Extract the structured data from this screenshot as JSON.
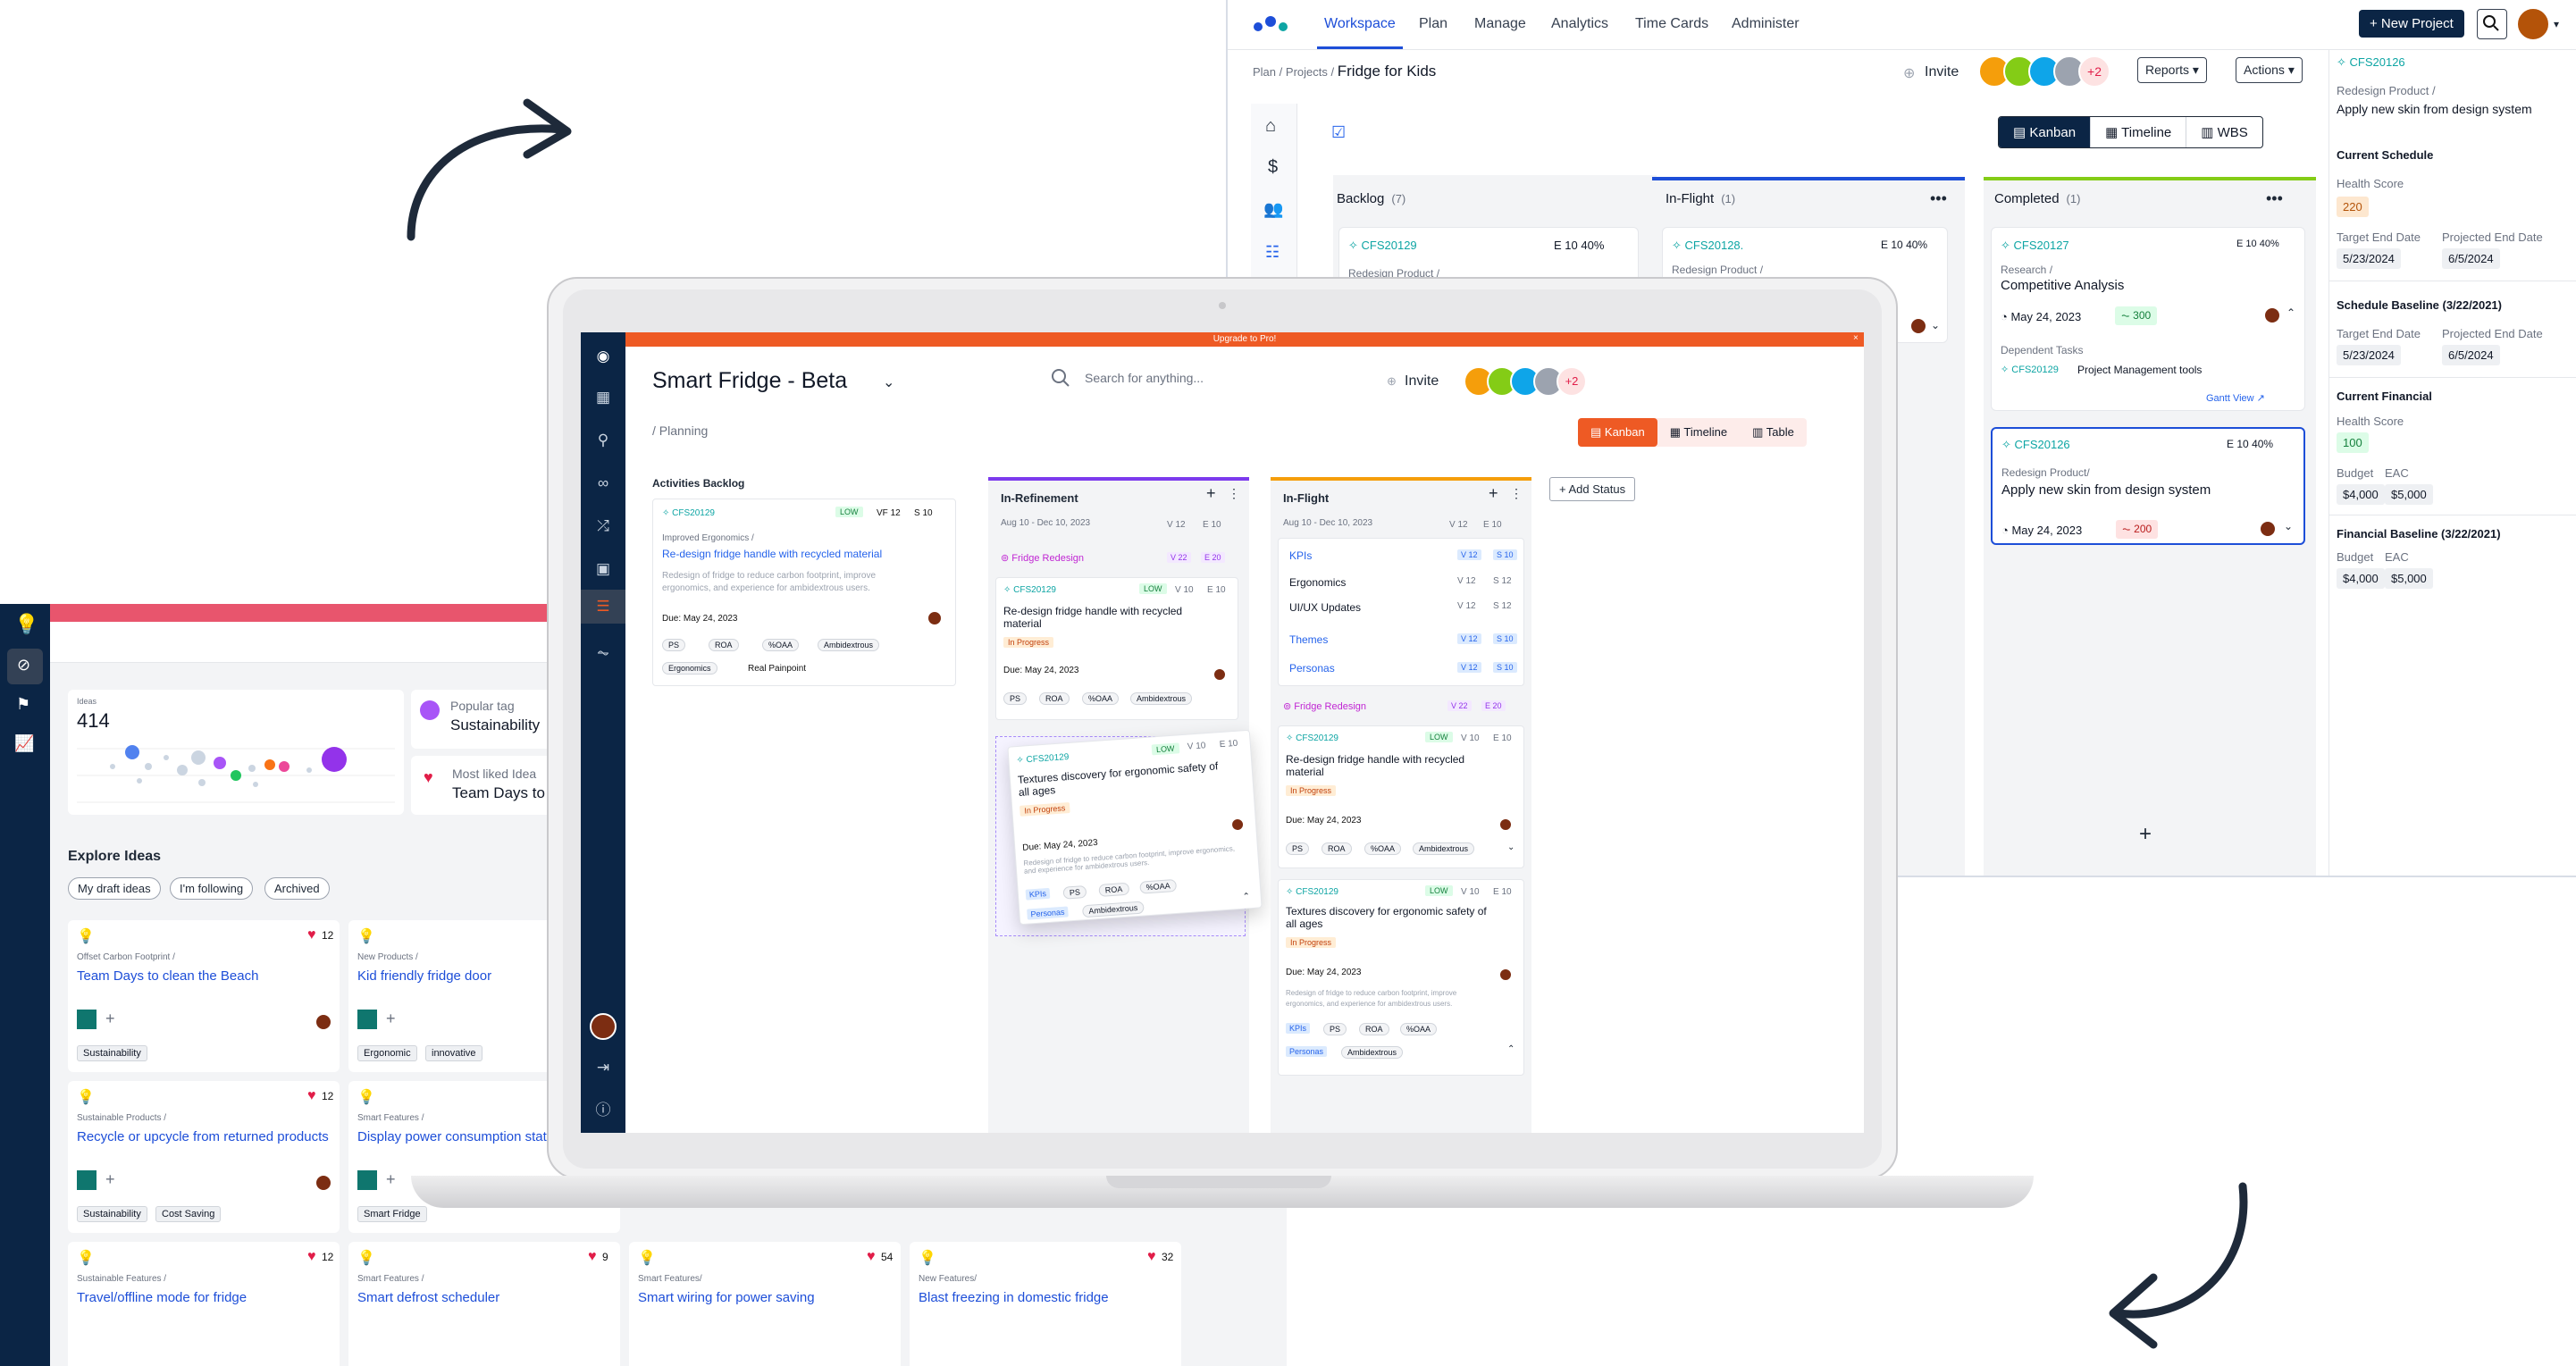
{
  "workspace": {
    "nav": [
      "Workspace",
      "Plan",
      "Manage",
      "Analytics",
      "Time Cards",
      "Administer"
    ],
    "new_project": "+ New Project",
    "breadcrumb": [
      "Plan",
      "/",
      "Projects",
      "/"
    ],
    "project_title": "Fridge for Kids",
    "invite": "Invite",
    "more_avatars": "+2",
    "reports": "Reports",
    "actions": "Actions",
    "views": [
      "Kanban",
      "Timeline",
      "WBS"
    ],
    "columns": [
      {
        "name": "Backlog",
        "count": "(7)"
      },
      {
        "name": "In-Flight",
        "count": "(1)"
      },
      {
        "name": "Completed",
        "count": "(1)"
      }
    ],
    "backlog_card": {
      "id": "CFS20129",
      "estimate": "E",
      "e_value": "10",
      "percent": "40%",
      "parent": "Redesign Product /"
    },
    "inflight_card": {
      "id": "CFS20128.",
      "estimate": "E",
      "e_value": "10",
      "percent": "40%",
      "parent": "Redesign Product /"
    },
    "completed_card1": {
      "id": "CFS20127",
      "estimate": "E",
      "e_value": "10",
      "percent": "40%",
      "parent": "Research /",
      "title": "Competitive Analysis",
      "date": "May 24, 2023",
      "score": "300",
      "dep_label": "Dependent Tasks",
      "dep_id": "CFS20129",
      "dep_title": "Project Management tools",
      "gantt": "Gantt View"
    },
    "completed_card2": {
      "id": "CFS20126",
      "estimate": "E",
      "e_value": "10",
      "percent": "40%",
      "parent": "Redesign Product/",
      "title": "Apply new skin from design system",
      "date": "May 24, 2023",
      "score": "200"
    },
    "add": "+",
    "side": {
      "id": "CFS20126",
      "parent": "Redesign Product /",
      "title": "Apply new skin from design system",
      "current_schedule": "Current Schedule",
      "health_label": "Health Score",
      "health_value": "220",
      "target_end": "Target End Date",
      "projected_end": "Projected End Date",
      "target_value": "5/23/2024",
      "projected_value": "6/5/2024",
      "schedule_baseline": "Schedule Baseline (3/22/2021)",
      "sb_target_value": "5/23/2024",
      "sb_projected_value": "6/5/2024",
      "current_financial": "Current Financial",
      "fin_health_value": "100",
      "budget": "Budget",
      "eac": "EAC",
      "budget_value": "$4,000",
      "eac_value": "$5,000",
      "financial_baseline": "Financial Baseline (3/22/2021)",
      "fb_budget_value": "$4,000",
      "fb_eac_value": "$5,000"
    }
  },
  "ideas": {
    "ideas_label": "Ideas",
    "ideas_count": "414",
    "popular_tag_label": "Popular tag",
    "popular_tag": "Sustainability",
    "most_liked_label": "Most liked Idea",
    "most_liked": "Team Days to",
    "explore": "Explore Ideas",
    "filters": [
      "My draft ideas",
      "I'm following",
      "Archived"
    ],
    "cards": [
      {
        "parent": "Offset Carbon Footprint /",
        "title": "Team Days to clean the Beach",
        "likes": "12",
        "tags": [
          "Sustainability"
        ]
      },
      {
        "parent": "New Products /",
        "title": "Kid friendly fridge door",
        "likes": "",
        "tags": [
          "Ergonomic",
          "innovative"
        ]
      },
      {
        "parent": "Sustainable Products /",
        "title": "Recycle or upcycle from returned products",
        "likes": "12",
        "tags": [
          "Sustainability",
          "Cost Saving"
        ]
      },
      {
        "parent": "Smart Features /",
        "title": "Display power consumption stats",
        "likes": "",
        "tags": [
          "Smart Fridge"
        ]
      },
      {
        "parent": "Sustainable Features /",
        "title": "Travel/offline mode for fridge",
        "likes": "12",
        "tags": []
      },
      {
        "parent": "Smart Features /",
        "title": "Smart defrost scheduler",
        "likes": "9",
        "tags": []
      },
      {
        "parent": "Smart Features/",
        "title": "Smart wiring for power saving",
        "likes": "54",
        "tags": []
      },
      {
        "parent": "New Features/",
        "title": "Blast freezing in domestic fridge",
        "likes": "32",
        "tags": []
      }
    ]
  },
  "app": {
    "upgrade": "Upgrade to Pro!",
    "title": "Smart Fridge - Beta",
    "search_placeholder": "Search for anything...",
    "invite": "Invite",
    "more_avatars": "+2",
    "crumb": "/ Planning",
    "views": [
      "Kanban",
      "Timeline",
      "Table"
    ],
    "backlog": {
      "heading": "Activities Backlog",
      "id": "CFS20129",
      "low": "LOW",
      "vf": "VF",
      "vf_value": "12",
      "s": "S",
      "s_value": "10",
      "parent": "Improved Ergonomics /",
      "title": "Re-design fridge handle with recycled material",
      "desc1": "Redesign of fridge to reduce carbon footprint, improve",
      "desc2": "ergonomics, and experience for ambidextrous users.",
      "due": "Due: May 24, 2023",
      "tags": [
        "PS",
        "ROA",
        "%OAA",
        "Ambidextrous",
        "Ergonomics"
      ],
      "pain": "Real Painpoint"
    },
    "refinement": {
      "name": "In-Refinement",
      "dates": "Aug 10 - Dec 10, 2023",
      "v": "V 12",
      "e": "E 10",
      "group": "Fridge Redesign",
      "gv": "V 22",
      "ge": "E 20",
      "card1": {
        "id": "CFS20129",
        "low": "LOW",
        "v": "V 10",
        "e": "E 10",
        "title1": "Re-design fridge handle with recycled",
        "title2": "material",
        "status": "In Progress",
        "due": "Due: May 24, 2023",
        "tags": [
          "PS",
          "ROA",
          "%OAA",
          "Ambidextrous"
        ]
      },
      "drag": {
        "id": "CFS20129",
        "low": "LOW",
        "v": "V 10",
        "e": "E 10",
        "title1": "Textures discovery for ergonomic safety of",
        "title2": "all ages",
        "status": "In Progress",
        "due": "Due: May 24, 2023",
        "desc": "Redesign of fridge to reduce carbon footprint, improve ergonomics, and experience for ambidextrous users.",
        "kpi": "KPIs",
        "pers": "Personas",
        "tags": [
          "PS",
          "ROA",
          "%OAA",
          "Ambidextrous"
        ]
      }
    },
    "inflight": {
      "name": "In-Flight",
      "dates": "Aug 10 - Dec 10, 2023",
      "v": "V 12",
      "e": "E 10",
      "rows": [
        {
          "name": "KPIs",
          "v": "V 12",
          "e": "S 10"
        },
        {
          "name": "Ergonomics",
          "v": "V 12",
          "e": "S 12"
        },
        {
          "name": "UI/UX Updates",
          "v": "V 12",
          "e": "S 12"
        },
        {
          "name": "Themes",
          "v": "V 12",
          "e": "S 10"
        },
        {
          "name": "Personas",
          "v": "V 12",
          "e": "S 10"
        }
      ],
      "group": "Fridge Redesign",
      "gv": "V 22",
      "ge": "E 20",
      "card1": {
        "id": "CFS20129",
        "low": "LOW",
        "v": "V 10",
        "e": "E 10",
        "title1": "Re-design fridge handle with recycled",
        "title2": "material",
        "status": "In Progress",
        "due": "Due: May 24, 2023",
        "tags": [
          "PS",
          "ROA",
          "%OAA",
          "Ambidextrous"
        ]
      },
      "card2": {
        "id": "CFS20129",
        "low": "LOW",
        "v": "V 10",
        "e": "E 10",
        "title1": "Textures discovery for ergonomic safety of",
        "title2": "all ages",
        "status": "In Progress",
        "due": "Due: May 24, 2023",
        "desc1": "Redesign of fridge to reduce carbon footprint, improve",
        "desc2": "ergonomics, and experience for ambidextrous users.",
        "kpi": "KPIs",
        "pers": "Personas",
        "tags": [
          "PS",
          "ROA",
          "%OAA",
          "Ambidextrous"
        ]
      }
    },
    "add_status": "+ Add Status"
  },
  "colors": {
    "navy": "#0b2545",
    "orange": "#ee5a24",
    "teal": "#0ea5a4",
    "pink": "#e8556d",
    "blue": "#1d4ed8",
    "purple": "#7c3aed",
    "amber": "#f59e0b",
    "green": "#84cc16"
  }
}
